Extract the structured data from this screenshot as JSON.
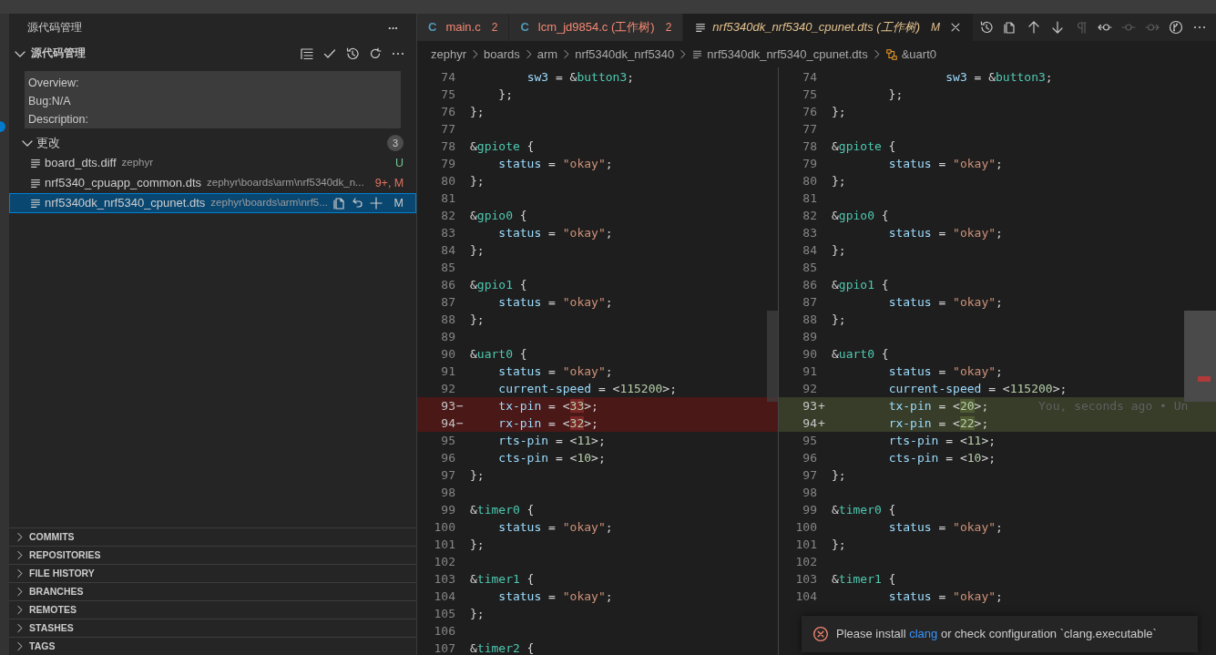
{
  "sidebar": {
    "title": "源代码管理",
    "more": "···",
    "section": {
      "title": "源代码管理",
      "expanded": true
    },
    "commit_message": [
      "Overview:",
      "Bug:N/A",
      "Description:"
    ],
    "changes": {
      "title": "更改",
      "expanded": true,
      "count": "3",
      "files": [
        {
          "name": "board_dts.diff",
          "path": "zephyr",
          "status": "U",
          "color": "#73c991",
          "selected": false
        },
        {
          "name": "nrf5340_cpuapp_common.dts",
          "path": "zephyr\\boards\\arm\\nrf5340dk_n...",
          "status": "9+, M",
          "color": "#e0735f",
          "selected": false
        },
        {
          "name": "nrf5340dk_nrf5340_cpunet.dts",
          "path": "zephyr\\boards\\arm\\nrf5...",
          "status": "M",
          "selected": true
        }
      ]
    },
    "panels": [
      {
        "title": "COMMITS",
        "expanded": false
      },
      {
        "title": "REPOSITORIES",
        "expanded": false
      },
      {
        "title": "FILE HISTORY",
        "expanded": false
      },
      {
        "title": "BRANCHES",
        "expanded": false
      },
      {
        "title": "REMOTES",
        "expanded": false
      },
      {
        "title": "STASHES",
        "expanded": false
      },
      {
        "title": "TAGS",
        "expanded": false
      }
    ]
  },
  "tabs": [
    {
      "kind": "c",
      "icon": "C",
      "label": "main.c",
      "badge": "2",
      "selected": false
    },
    {
      "kind": "c",
      "icon": "C",
      "label": "lcm_jd9854.c (工作树)",
      "badge": "2",
      "selected": false
    },
    {
      "kind": "text",
      "label": "nrf5340dk_nrf5340_cpunet.dts (工作树)",
      "badge": "M",
      "selected": true
    }
  ],
  "toolbar": [
    {
      "kind": "history",
      "disabled": false
    },
    {
      "kind": "open-file",
      "disabled": false
    },
    {
      "kind": "up",
      "disabled": false
    },
    {
      "kind": "down",
      "disabled": false
    },
    {
      "kind": "pilcrow",
      "disabled": true
    },
    {
      "kind": "commit-back",
      "disabled": false
    },
    {
      "kind": "commit",
      "disabled": true
    },
    {
      "kind": "commit-forward",
      "disabled": true
    },
    {
      "kind": "compare",
      "disabled": false
    },
    {
      "kind": "more",
      "disabled": false
    }
  ],
  "breadcrumbs": [
    {
      "kind": "folder",
      "label": "zephyr"
    },
    {
      "kind": "folder",
      "label": "boards"
    },
    {
      "kind": "folder",
      "label": "arm"
    },
    {
      "kind": "folder",
      "label": "nrf5340dk_nrf5340"
    },
    {
      "kind": "file",
      "label": "nrf5340dk_nrf5340_cpunet.dts"
    },
    {
      "kind": "symbol",
      "label": "&uart0"
    }
  ],
  "diff": {
    "left": [
      {
        "number": "74",
        "text": "        sw3 = &button3;"
      },
      {
        "number": "75",
        "text": "    };"
      },
      {
        "number": "76",
        "text": "};"
      },
      {
        "number": "77"
      },
      {
        "number": "78",
        "text": "&gpiote {"
      },
      {
        "number": "79",
        "text": "    status = \"okay\";"
      },
      {
        "number": "80",
        "text": "};"
      },
      {
        "number": "81"
      },
      {
        "number": "82",
        "text": "&gpio0 {"
      },
      {
        "number": "83",
        "text": "    status = \"okay\";"
      },
      {
        "number": "84",
        "text": "};"
      },
      {
        "number": "85"
      },
      {
        "number": "86",
        "text": "&gpio1 {"
      },
      {
        "number": "87",
        "text": "    status = \"okay\";"
      },
      {
        "number": "88",
        "text": "};"
      },
      {
        "number": "89"
      },
      {
        "number": "90",
        "text": "&uart0 {"
      },
      {
        "number": "91",
        "text": "    status = \"okay\";"
      },
      {
        "number": "92",
        "text": "    current-speed = <115200>;"
      },
      {
        "number": "93",
        "kind": "removed",
        "marker": "−",
        "segments": [
          {
            "text": "    tx-pin = <",
            "changed": false
          },
          {
            "text": "33",
            "changed": true
          },
          {
            "text": ">;",
            "changed": false
          }
        ]
      },
      {
        "number": "94",
        "kind": "removed",
        "marker": "−",
        "segments": [
          {
            "text": "    rx-pin = <",
            "changed": false
          },
          {
            "text": "32",
            "changed": true
          },
          {
            "text": ">;",
            "changed": false
          }
        ]
      },
      {
        "number": "95",
        "text": "    rts-pin = <11>;"
      },
      {
        "number": "96",
        "text": "    cts-pin = <10>;"
      },
      {
        "number": "97",
        "text": "};"
      },
      {
        "number": "98"
      },
      {
        "number": "99",
        "text": "&timer0 {"
      },
      {
        "number": "100",
        "text": "    status = \"okay\";"
      },
      {
        "number": "101",
        "text": "};"
      },
      {
        "number": "102"
      },
      {
        "number": "103",
        "text": "&timer1 {"
      },
      {
        "number": "104",
        "text": "    status = \"okay\";"
      },
      {
        "number": "105",
        "text": "};"
      },
      {
        "number": "106"
      },
      {
        "number": "107",
        "text": "&timer2 {"
      }
    ],
    "right": [
      {
        "number": "74",
        "text": "                sw3 = &button3;"
      },
      {
        "number": "75",
        "text": "        };"
      },
      {
        "number": "76",
        "text": "};"
      },
      {
        "number": "77"
      },
      {
        "number": "78",
        "text": "&gpiote {"
      },
      {
        "number": "79",
        "text": "        status = \"okay\";"
      },
      {
        "number": "80",
        "text": "};"
      },
      {
        "number": "81"
      },
      {
        "number": "82",
        "text": "&gpio0 {"
      },
      {
        "number": "83",
        "text": "        status = \"okay\";"
      },
      {
        "number": "84",
        "text": "};"
      },
      {
        "number": "85"
      },
      {
        "number": "86",
        "text": "&gpio1 {"
      },
      {
        "number": "87",
        "text": "        status = \"okay\";"
      },
      {
        "number": "88",
        "text": "};"
      },
      {
        "number": "89"
      },
      {
        "number": "90",
        "text": "&uart0 {"
      },
      {
        "number": "91",
        "text": "        status = \"okay\";"
      },
      {
        "number": "92",
        "text": "        current-speed = <115200>;"
      },
      {
        "number": "93",
        "kind": "added",
        "marker": "+",
        "blame": "You, seconds ago • Un",
        "segments": [
          {
            "text": "        tx-pin = <",
            "changed": false
          },
          {
            "text": "20",
            "changed": true
          },
          {
            "text": ">;",
            "changed": false
          }
        ]
      },
      {
        "number": "94",
        "kind": "added",
        "marker": "+",
        "segments": [
          {
            "text": "        rx-pin = <",
            "changed": false
          },
          {
            "text": "22",
            "changed": true
          },
          {
            "text": ">;",
            "changed": false
          }
        ]
      },
      {
        "number": "95",
        "text": "        rts-pin = <11>;"
      },
      {
        "number": "96",
        "text": "        cts-pin = <10>;"
      },
      {
        "number": "97",
        "text": "};"
      },
      {
        "number": "98"
      },
      {
        "number": "99",
        "text": "&timer0 {"
      },
      {
        "number": "100",
        "text": "        status = \"okay\";"
      },
      {
        "number": "101",
        "text": "};"
      },
      {
        "number": "102"
      },
      {
        "number": "103",
        "text": "&timer1 {"
      },
      {
        "number": "104",
        "text": "        status = \"okay\";"
      }
    ]
  },
  "notification": {
    "kind": "error",
    "before": "Please install ",
    "link": "clang",
    "after": " or check configuration `clang.executable`"
  }
}
